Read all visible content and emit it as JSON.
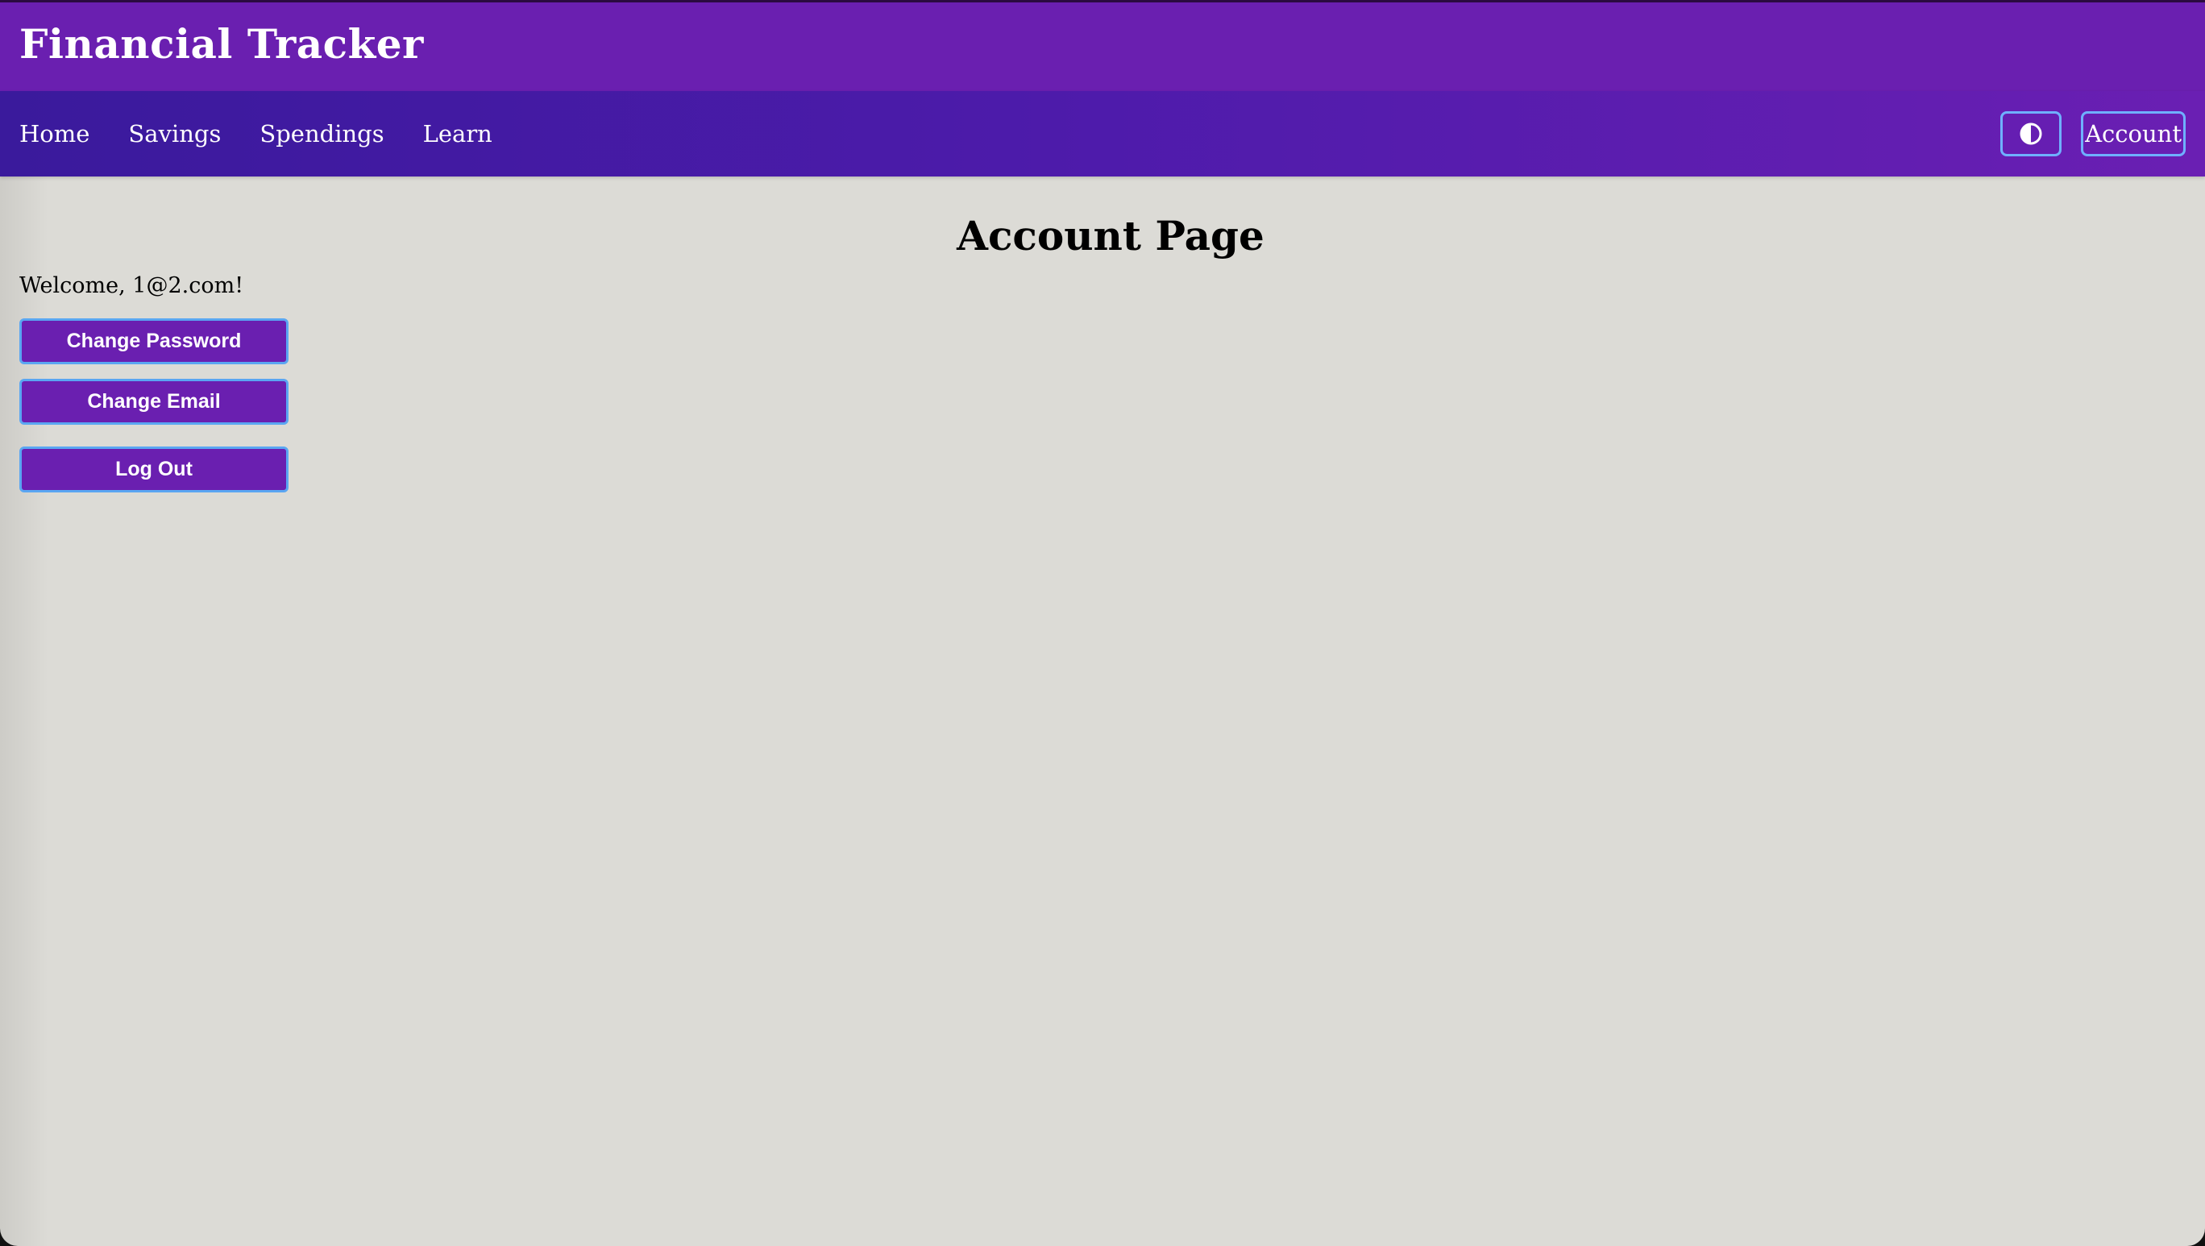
{
  "app": {
    "title": "Financial Tracker"
  },
  "nav": {
    "links": [
      {
        "label": "Home"
      },
      {
        "label": "Savings"
      },
      {
        "label": "Spendings"
      },
      {
        "label": "Learn"
      }
    ],
    "theme_toggle_icon": "half-circle-contrast-icon",
    "account_label": "Account"
  },
  "page": {
    "title": "Account Page",
    "welcome": "Welcome, 1@2.com!",
    "buttons": {
      "change_password": "Change Password",
      "change_email": "Change Email",
      "log_out": "Log Out"
    }
  },
  "colors": {
    "header": "#6a1fb0",
    "nav_gradient_start": "#3a1a9c",
    "nav_gradient_end": "#6a1fb3",
    "button_bg": "#6a1fb0",
    "button_border": "#5aa6f2",
    "page_bg": "#dcdbd6"
  }
}
